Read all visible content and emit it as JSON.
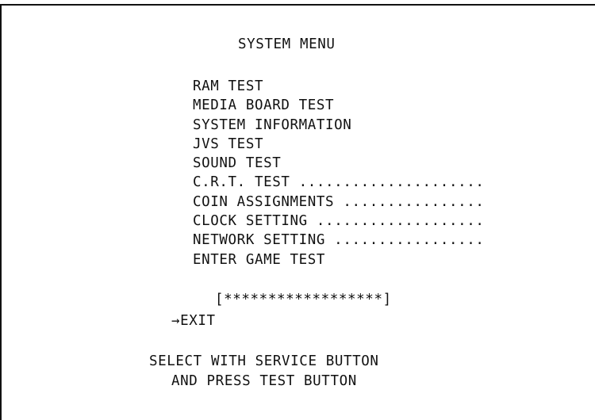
{
  "screen": {
    "title": "SYSTEM MENU",
    "menu_items": [
      {
        "label": "RAM TEST",
        "leader": ""
      },
      {
        "label": "MEDIA BOARD TEST",
        "leader": ""
      },
      {
        "label": "SYSTEM INFORMATION",
        "leader": ""
      },
      {
        "label": "JVS TEST",
        "leader": ""
      },
      {
        "label": "SOUND TEST",
        "leader": ""
      },
      {
        "label": "C.R.T. TEST",
        "leader": " ....................."
      },
      {
        "label": "COIN ASSIGNMENTS",
        "leader": " ................"
      },
      {
        "label": "CLOCK SETTING",
        "leader": " ..................."
      },
      {
        "label": "NETWORK SETTING",
        "leader": " ................."
      },
      {
        "label": "ENTER GAME TEST",
        "leader": ""
      }
    ],
    "progress": "[******************]",
    "cursor_arrow": "→",
    "exit_label": "EXIT",
    "instructions_line1": "SELECT WITH SERVICE BUTTON",
    "instructions_line2": "AND PRESS TEST BUTTON"
  }
}
